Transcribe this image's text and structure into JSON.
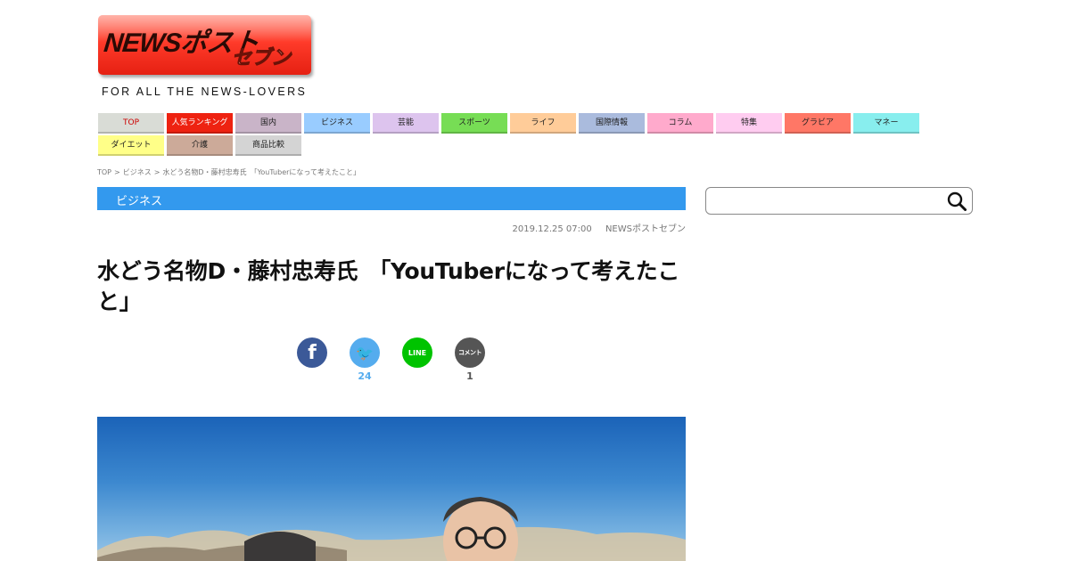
{
  "logo": {
    "text": "NEWSポスト",
    "text2": "セブン"
  },
  "tagline": "FOR ALL THE NEWS-LOVERS",
  "nav": [
    {
      "label": "TOP",
      "bg": "#d9dcd6",
      "color": "#cc0000"
    },
    {
      "label": "人気ランキング",
      "bg": "#ee2211",
      "color": "#ffffff"
    },
    {
      "label": "国内",
      "bg": "#c9b4c8",
      "color": "#222222"
    },
    {
      "label": "ビジネス",
      "bg": "#99ccff",
      "color": "#222222"
    },
    {
      "label": "芸能",
      "bg": "#ddc4ee",
      "color": "#222222"
    },
    {
      "label": "スポーツ",
      "bg": "#77dd55",
      "color": "#222222"
    },
    {
      "label": "ライフ",
      "bg": "#ffcc99",
      "color": "#222222"
    },
    {
      "label": "国際情報",
      "bg": "#aabbdd",
      "color": "#222222"
    },
    {
      "label": "コラム",
      "bg": "#ffaacc",
      "color": "#222222"
    },
    {
      "label": "特集",
      "bg": "#ffccf0",
      "color": "#222222"
    },
    {
      "label": "グラビア",
      "bg": "#ff7766",
      "color": "#222222"
    },
    {
      "label": "マネー",
      "bg": "#88eeee",
      "color": "#222222"
    },
    {
      "label": "ダイエット",
      "bg": "#ffff88",
      "color": "#222222"
    },
    {
      "label": "介護",
      "bg": "#ccaa99",
      "color": "#222222"
    },
    {
      "label": "商品比較",
      "bg": "#d4d4d4",
      "color": "#222222"
    }
  ],
  "breadcrumb": [
    {
      "label": "TOP"
    },
    {
      "label": ">"
    },
    {
      "label": "ビジネス"
    },
    {
      "label": ">"
    },
    {
      "label": "水どう名物D・藤村忠寿氏　「YouTuberになって考えたこと」"
    }
  ],
  "category": "ビジネス",
  "meta": {
    "date": "2019.12.25 07:00",
    "source": "NEWSポストセブン"
  },
  "headline": "水どう名物D・藤村忠寿氏　「YouTuberになって考えたこと」",
  "share": [
    {
      "name": "facebook",
      "glyph": "f",
      "count": "",
      "color": "#3b5998"
    },
    {
      "name": "twitter",
      "glyph": "🐦",
      "count": "24",
      "color": "#55acee"
    },
    {
      "name": "line",
      "glyph": "LINE",
      "count": "",
      "color": "#00c300"
    },
    {
      "name": "comment",
      "glyph": "コメント",
      "count": "1",
      "color": "#555555"
    }
  ],
  "search": {
    "placeholder": "",
    "value": "",
    "icon": "magnifier-icon"
  },
  "photo": {
    "description_icon": "article-photo"
  }
}
